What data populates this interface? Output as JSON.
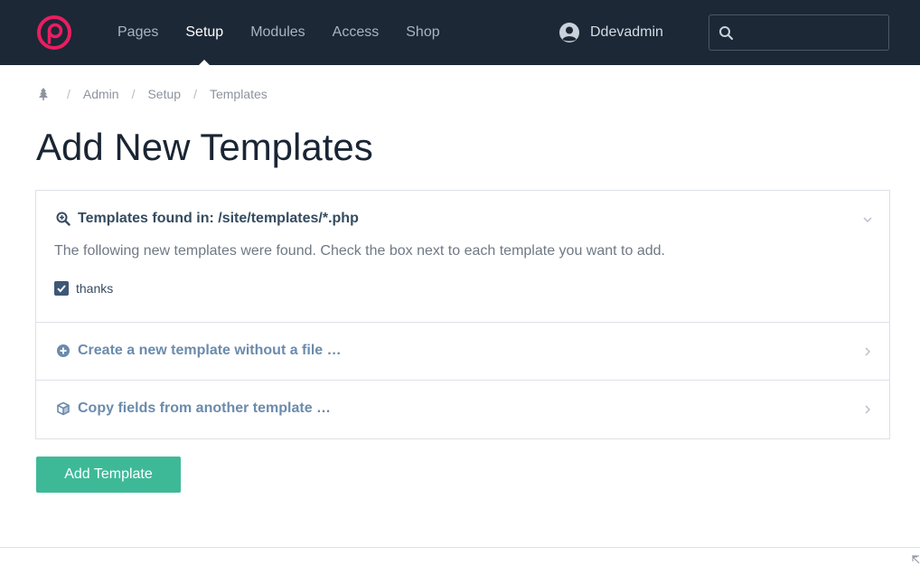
{
  "header": {
    "nav": [
      "Pages",
      "Setup",
      "Modules",
      "Access",
      "Shop"
    ],
    "active_nav": "Setup",
    "user_name": "Ddevadmin",
    "search_value": "",
    "colors": {
      "bar": "#1c2836",
      "logo": "#eb1d61"
    }
  },
  "breadcrumb": {
    "home_icon": "tree-icon",
    "items": [
      "Admin",
      "Setup",
      "Templates"
    ],
    "separator": "/"
  },
  "page": {
    "title": "Add New Templates"
  },
  "sections": [
    {
      "icon": "search-plus-icon",
      "title": "Templates found in: /site/templates/*.php",
      "description": "The following new templates were found. Check the box next to each template you want to add.",
      "checkbox_label": "thanks",
      "checked": true,
      "expanded": true
    },
    {
      "icon": "plus-circle-icon",
      "title": "Create a new template without a file …",
      "expanded": false
    },
    {
      "icon": "cube-icon",
      "title": "Copy fields from another template …",
      "expanded": false
    }
  ],
  "submit_label": "Add Template",
  "accent_colors": {
    "button": "#3eb998",
    "section_title_dark": "#354b60",
    "section_title_light": "#6b8bac"
  }
}
